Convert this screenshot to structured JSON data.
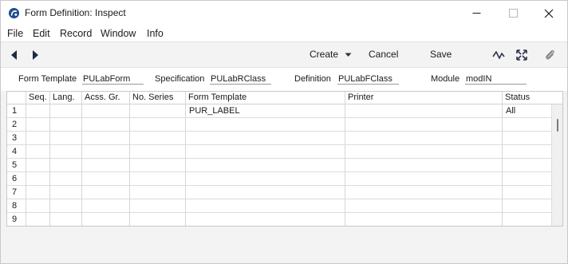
{
  "window": {
    "title": "Form Definition: Inspect",
    "app_icon": "app-logo-icon",
    "controls": [
      "minimize-icon",
      "maximize-icon",
      "close-icon"
    ]
  },
  "menu": {
    "items": [
      {
        "label": "File"
      },
      {
        "label": "Edit"
      },
      {
        "label": "Record"
      },
      {
        "label": "Window"
      },
      {
        "label": "Info"
      }
    ]
  },
  "toolbar": {
    "prev_icon": "triangle-left-icon",
    "next_icon": "triangle-right-icon",
    "create_label": "Create",
    "cancel_label": "Cancel",
    "save_label": "Save",
    "icons": [
      "activity-icon",
      "expand-icon",
      "paperclip-icon"
    ]
  },
  "header": {
    "form_template_label": "Form Template",
    "form_template_value": "PULabForm",
    "specification_label": "Specification",
    "specification_value": "PULabRClass",
    "definition_label": "Definition",
    "definition_value": "PULabFClass",
    "module_label": "Module",
    "module_value": "modIN"
  },
  "grid": {
    "columns": [
      "Seq.",
      "Lang.",
      "Acss. Gr.",
      "No. Series",
      "Form Template",
      "Printer",
      "Status"
    ],
    "rows": [
      {
        "num": "1",
        "seq": "",
        "lang": "",
        "acss": "",
        "series": "",
        "form_template": "PUR_LABEL",
        "printer": "",
        "status": "All"
      },
      {
        "num": "2",
        "seq": "",
        "lang": "",
        "acss": "",
        "series": "",
        "form_template": "",
        "printer": "",
        "status": ""
      },
      {
        "num": "3",
        "seq": "",
        "lang": "",
        "acss": "",
        "series": "",
        "form_template": "",
        "printer": "",
        "status": ""
      },
      {
        "num": "4",
        "seq": "",
        "lang": "",
        "acss": "",
        "series": "",
        "form_template": "",
        "printer": "",
        "status": ""
      },
      {
        "num": "5",
        "seq": "",
        "lang": "",
        "acss": "",
        "series": "",
        "form_template": "",
        "printer": "",
        "status": ""
      },
      {
        "num": "6",
        "seq": "",
        "lang": "",
        "acss": "",
        "series": "",
        "form_template": "",
        "printer": "",
        "status": ""
      },
      {
        "num": "7",
        "seq": "",
        "lang": "",
        "acss": "",
        "series": "",
        "form_template": "",
        "printer": "",
        "status": ""
      },
      {
        "num": "8",
        "seq": "",
        "lang": "",
        "acss": "",
        "series": "",
        "form_template": "",
        "printer": "",
        "status": ""
      },
      {
        "num": "9",
        "seq": "",
        "lang": "",
        "acss": "",
        "series": "",
        "form_template": "",
        "printer": "",
        "status": ""
      }
    ]
  }
}
